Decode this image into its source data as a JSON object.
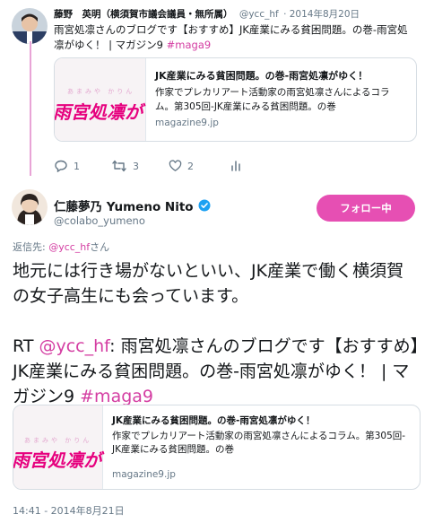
{
  "parent_tweet": {
    "author_name": "藤野　英明（横須賀市議会議員・無所属）",
    "author_handle": "@ycc_hf",
    "date": "· 2014年8月20日",
    "text_prefix": "雨宮処凛さんのブログです【おすすめ】JK産業にみる貧困問題。の巻-雨宮処凛がゆく！ | マガジン9 ",
    "hashtag": "#maga9",
    "card": {
      "thumb_small": "あまみや かりん",
      "thumb_big": "雨宮処凛が",
      "title": "JK産業にみる貧困問題。の巻-雨宮処凛がゆく！",
      "description": "作家でプレカリアート活動家の雨宮処凛さんによるコラム。第305回-JK産業にみる貧困問題。の巻",
      "url": "magazine9.jp"
    },
    "actions": {
      "reply_count": "1",
      "retweet_count": "3",
      "like_count": "2"
    }
  },
  "main_tweet": {
    "author_name": "仁藤夢乃 Yumeno Nito",
    "author_handle": "@colabo_yumeno",
    "follow_label": "フォロー中",
    "reply_prefix": "返信先: ",
    "reply_mention": "@ycc_hf",
    "reply_suffix": "さん",
    "line1": "地元には行き場がないといい、JK産業で働く横須賀の女子高生にも会っています。",
    "rt_prefix": "RT ",
    "rt_mention": "@ycc_hf",
    "rt_text": ": 雨宮処凛さんのブログです【おすすめ】JK産業にみる貧困問題。の巻-雨宮処凛がゆく！ | マガジン9 ",
    "hashtag": "#maga9",
    "card": {
      "thumb_small": "あまみや かりん",
      "thumb_big": "雨宮処凛が",
      "title": "JK産業にみる貧困問題。の巻-雨宮処凛がゆく！",
      "description": "作家でプレカリアート活動家の雨宮処凛さんによるコラム。第305回-JK産業にみる貧困問題。の巻",
      "url": "magazine9.jp"
    },
    "timestamp": "14:41 - 2014年8月21日"
  },
  "colors": {
    "accent": "#e64fb3",
    "link": "#d43da2",
    "muted": "#657786",
    "verified": "#1da1f2"
  }
}
